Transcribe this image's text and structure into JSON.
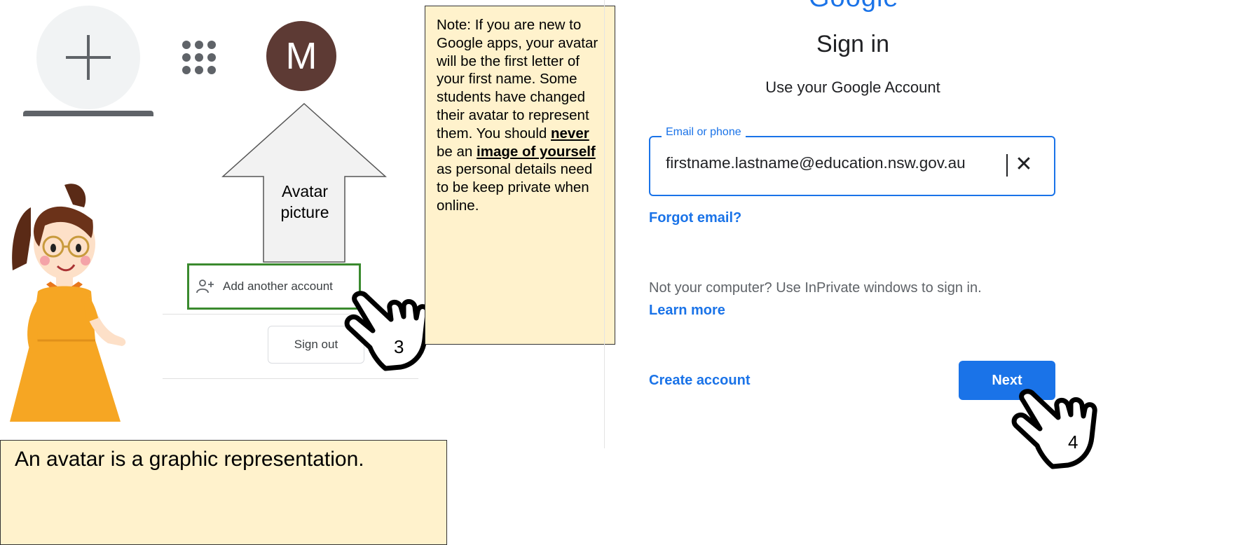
{
  "account_panel": {
    "avatar_letter": "M",
    "arrow_label": "Avatar picture",
    "add_account_label": "Add another account",
    "sign_out_label": "Sign out",
    "step_3": "3"
  },
  "note": {
    "text_1": "Note: If you are new to Google apps, your avatar will be the first letter of your first name. Some students have changed their avatar to represent them. You should",
    "never": "never",
    "text_2": "be an",
    "image_of_yourself": "image of yourself",
    "text_3": "as personal details need to be keep private when online."
  },
  "caption": "An avatar is a graphic representation.",
  "signin": {
    "logo": "Google",
    "title": "Sign in",
    "subtitle": "Use your Google Account",
    "email_label": "Email or phone",
    "email_value": "firstname.lastname@education.nsw.gov.au",
    "forgot_email": "Forgot email?",
    "private_text": "Not your computer? Use InPrivate windows to sign in.",
    "learn_more": "Learn more",
    "create_account": "Create account",
    "next_label": "Next",
    "step_4": "4"
  },
  "colors": {
    "google_blue": "#1a73e8",
    "avatar_bg": "#5d3a34",
    "note_bg": "#fff2cc",
    "highlight_green": "#3a8a2e"
  },
  "icons": [
    "plus-icon",
    "apps-grid-icon",
    "add-person-icon",
    "clear-icon",
    "pointing-hand-icon"
  ]
}
